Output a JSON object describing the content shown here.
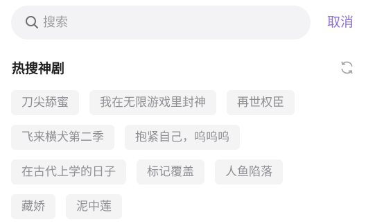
{
  "search": {
    "placeholder": "搜索",
    "cancel_label": "取消"
  },
  "hot_section": {
    "title": "热搜神剧",
    "rows": [
      [
        "刀尖舔蜜",
        "我在无限游戏里封神",
        "再世权臣"
      ],
      [
        "飞来横犬第二季",
        "抱紧自己，呜呜呜"
      ],
      [
        "在古代上学的日子",
        "标记覆盖",
        "人鱼陷落"
      ],
      [
        "藏娇",
        "泥中莲"
      ]
    ]
  },
  "icons": {
    "search": "search-icon",
    "refresh": "refresh-icon"
  },
  "colors": {
    "accent": "#8f6fd6",
    "search_bg": "#f3f3f5",
    "tag_bg": "#f4f4f5",
    "tag_text": "#8e8e93",
    "title_text": "#1f1f1f"
  }
}
